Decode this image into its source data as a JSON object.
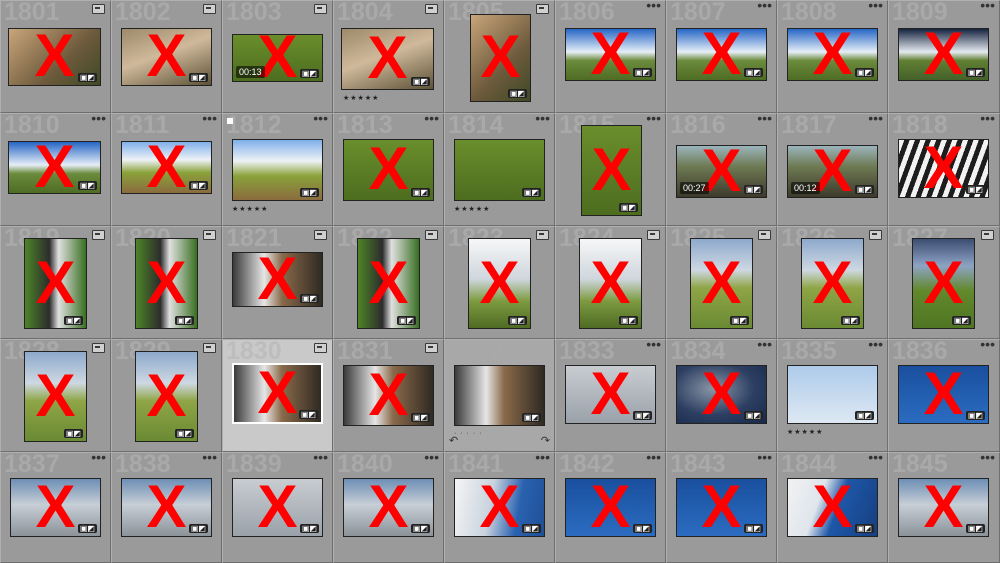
{
  "app": "Lightroom Library Grid",
  "cells": [
    {
      "num": "1801",
      "style": "g-lion",
      "mark": "X",
      "rating": "",
      "duration": "",
      "badge": "doc"
    },
    {
      "num": "1802",
      "style": "g-lion2",
      "mark": "X",
      "rating": "",
      "duration": "",
      "badge": "doc"
    },
    {
      "num": "1803",
      "style": "g-grass",
      "mark": "X",
      "rating": "",
      "duration": "00:13",
      "badge": "doc"
    },
    {
      "num": "1804",
      "style": "g-lion2",
      "mark": "X",
      "rating": "★★★★★",
      "duration": "",
      "badge": "doc"
    },
    {
      "num": "1805",
      "style": "g-lion",
      "mark": "X",
      "rating": "",
      "duration": "",
      "badge": "doc"
    },
    {
      "num": "1806",
      "style": "g-sky",
      "mark": "X",
      "rating": "",
      "duration": "",
      "badge": "dots"
    },
    {
      "num": "1807",
      "style": "g-sky",
      "mark": "X",
      "rating": "",
      "duration": "",
      "badge": "dots"
    },
    {
      "num": "1808",
      "style": "g-sky",
      "mark": "X",
      "rating": "",
      "duration": "",
      "badge": "dots"
    },
    {
      "num": "1809",
      "style": "g-skyd",
      "mark": "X",
      "rating": "",
      "duration": "",
      "badge": "dots"
    },
    {
      "num": "1810",
      "style": "g-sky",
      "mark": "X",
      "rating": "",
      "duration": "",
      "badge": "dots"
    },
    {
      "num": "1811",
      "style": "g-road",
      "mark": "X",
      "rating": "",
      "duration": "",
      "badge": "dots"
    },
    {
      "num": "1812",
      "style": "g-road",
      "mark": "",
      "rating": "★★★★★",
      "duration": "",
      "badge": "dots",
      "flag": true
    },
    {
      "num": "1813",
      "style": "g-grass",
      "mark": "X",
      "rating": "",
      "duration": "",
      "badge": "dots"
    },
    {
      "num": "1814",
      "style": "g-grass",
      "mark": "",
      "rating": "★★★★★",
      "duration": "",
      "badge": "dots"
    },
    {
      "num": "1815",
      "style": "g-grass",
      "mark": "X",
      "rating": "",
      "duration": "",
      "badge": "dots"
    },
    {
      "num": "1816",
      "style": "g-herd",
      "mark": "X",
      "rating": "",
      "duration": "00:27",
      "badge": "dots"
    },
    {
      "num": "1817",
      "style": "g-herd",
      "mark": "X",
      "rating": "",
      "duration": "00:12",
      "badge": "dots"
    },
    {
      "num": "1818",
      "style": "g-zebra",
      "mark": "X",
      "rating": "",
      "duration": "",
      "badge": "dots"
    },
    {
      "num": "1819",
      "style": "g-zebragr",
      "mark": "X",
      "rating": "",
      "duration": "",
      "badge": "doc"
    },
    {
      "num": "1820",
      "style": "g-zebragr",
      "mark": "X",
      "rating": "",
      "duration": "",
      "badge": "doc"
    },
    {
      "num": "1821",
      "style": "g-people",
      "mark": "X",
      "rating": "",
      "duration": "",
      "badge": "doc"
    },
    {
      "num": "1822",
      "style": "g-zebragr",
      "mark": "X",
      "rating": "",
      "duration": "",
      "badge": "doc"
    },
    {
      "num": "1823",
      "style": "g-cloud",
      "mark": "X",
      "rating": "",
      "duration": "",
      "badge": "doc"
    },
    {
      "num": "1824",
      "style": "g-cloud",
      "mark": "X",
      "rating": "",
      "duration": "",
      "badge": "doc"
    },
    {
      "num": "1825",
      "style": "g-hills",
      "mark": "X",
      "rating": "",
      "duration": "",
      "badge": "doc"
    },
    {
      "num": "1826",
      "style": "g-hills",
      "mark": "X",
      "rating": "",
      "duration": "",
      "badge": "doc"
    },
    {
      "num": "1827",
      "style": "g-hillsd",
      "mark": "X",
      "rating": "",
      "duration": "",
      "badge": "doc"
    },
    {
      "num": "1828",
      "style": "g-hills",
      "mark": "X",
      "rating": "",
      "duration": "",
      "badge": "doc"
    },
    {
      "num": "1829",
      "style": "g-hills",
      "mark": "X",
      "rating": "",
      "duration": "",
      "badge": "doc"
    },
    {
      "num": "1830",
      "style": "g-people",
      "mark": "X",
      "rating": "",
      "duration": "",
      "badge": "doc",
      "selected": true
    },
    {
      "num": "1831",
      "style": "g-people",
      "mark": "X",
      "rating": "",
      "duration": "",
      "badge": "doc"
    },
    {
      "num": "1832",
      "style": "g-people",
      "mark": "",
      "rating": "· · · · ·",
      "duration": "",
      "badge": "",
      "candidate": true
    },
    {
      "num": "1833",
      "style": "g-graysky",
      "mark": "X",
      "rating": "",
      "duration": "",
      "badge": "dots"
    },
    {
      "num": "1834",
      "style": "g-darksky",
      "mark": "X",
      "rating": "",
      "duration": "",
      "badge": "dots"
    },
    {
      "num": "1835",
      "style": "g-bluesky",
      "mark": "",
      "rating": "★★★★★",
      "duration": "",
      "badge": "dots"
    },
    {
      "num": "1836",
      "style": "g-deep",
      "mark": "X",
      "rating": "",
      "duration": "",
      "badge": "dots"
    },
    {
      "num": "1837",
      "style": "g-mix",
      "mark": "X",
      "rating": "",
      "duration": "",
      "badge": "dots"
    },
    {
      "num": "1838",
      "style": "g-mix",
      "mark": "X",
      "rating": "",
      "duration": "",
      "badge": "dots"
    },
    {
      "num": "1839",
      "style": "g-graysky",
      "mark": "X",
      "rating": "",
      "duration": "",
      "badge": "dots"
    },
    {
      "num": "1840",
      "style": "g-mix",
      "mark": "X",
      "rating": "",
      "duration": "",
      "badge": "dots"
    },
    {
      "num": "1841",
      "style": "g-cloudblue",
      "mark": "X",
      "rating": "",
      "duration": "",
      "badge": "dots"
    },
    {
      "num": "1842",
      "style": "g-deep",
      "mark": "X",
      "rating": "",
      "duration": "",
      "badge": "dots"
    },
    {
      "num": "1843",
      "style": "g-deep",
      "mark": "X",
      "rating": "",
      "duration": "",
      "badge": "dots"
    },
    {
      "num": "1844",
      "style": "g-whiteblue",
      "mark": "X",
      "rating": "",
      "duration": "",
      "badge": "dots"
    },
    {
      "num": "1845",
      "style": "g-mix",
      "mark": "X",
      "rating": "",
      "duration": "",
      "badge": "dots"
    }
  ],
  "overlay_badge": "▣◩",
  "rotate_left": "↶",
  "rotate_right": "↷"
}
